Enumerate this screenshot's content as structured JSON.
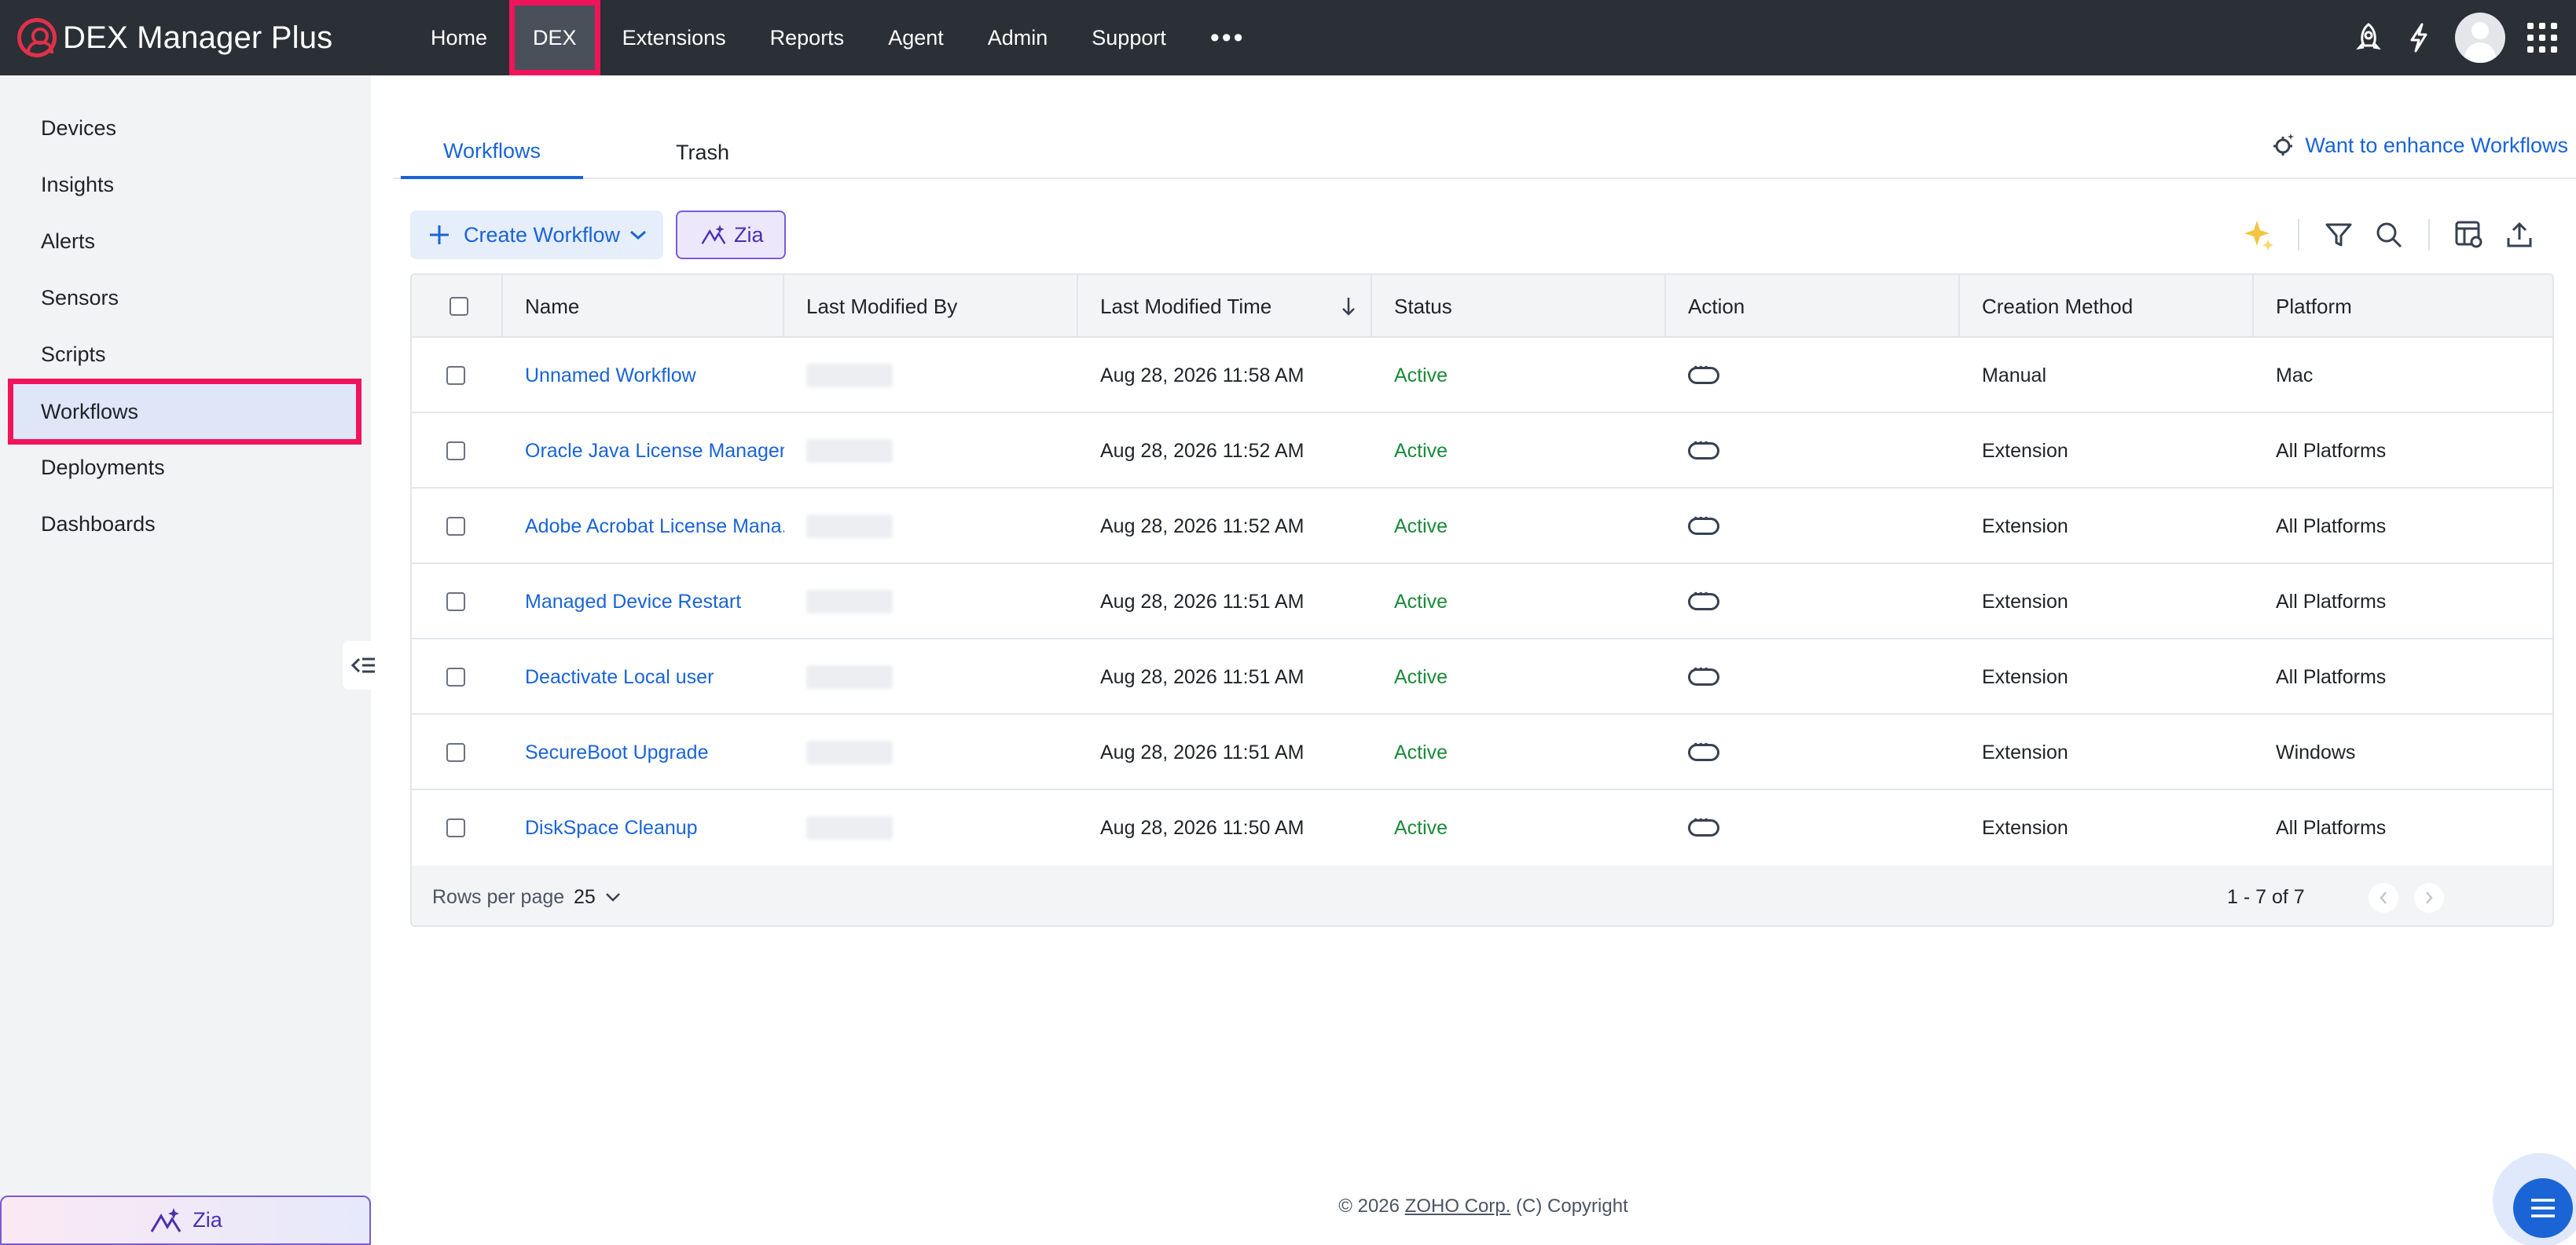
{
  "app": {
    "title": "DEX Manager Plus"
  },
  "nav": {
    "items": [
      {
        "label": "Home",
        "active": false
      },
      {
        "label": "DEX",
        "active": true
      },
      {
        "label": "Extensions",
        "active": false
      },
      {
        "label": "Reports",
        "active": false
      },
      {
        "label": "Agent",
        "active": false
      },
      {
        "label": "Admin",
        "active": false
      },
      {
        "label": "Support",
        "active": false
      }
    ],
    "more": "•••"
  },
  "sidebar": {
    "items": [
      {
        "label": "Devices"
      },
      {
        "label": "Insights"
      },
      {
        "label": "Alerts"
      },
      {
        "label": "Sensors"
      },
      {
        "label": "Scripts"
      },
      {
        "label": "Workflows",
        "active": true
      },
      {
        "label": "Deployments"
      },
      {
        "label": "Dashboards"
      }
    ],
    "zia_label": "Zia"
  },
  "tabs": [
    {
      "label": "Workflows",
      "active": true
    },
    {
      "label": "Trash",
      "active": false
    }
  ],
  "enhance_link": "Want to enhance Workflows",
  "toolbar": {
    "create_label": "Create Workflow",
    "zia_label": "Zia"
  },
  "table": {
    "columns": [
      "Name",
      "Last Modified By",
      "Last Modified Time",
      "Status",
      "Action",
      "Creation Method",
      "Platform"
    ],
    "rows": [
      {
        "name": "Unnamed Workflow",
        "time": "Aug 28, 2026 11:58 AM",
        "status": "Active",
        "method": "Manual",
        "platform": "Mac"
      },
      {
        "name": "Oracle Java License Managem...",
        "time": "Aug 28, 2026 11:52 AM",
        "status": "Active",
        "method": "Extension",
        "platform": "All Platforms"
      },
      {
        "name": "Adobe Acrobat License Mana...",
        "time": "Aug 28, 2026 11:52 AM",
        "status": "Active",
        "method": "Extension",
        "platform": "All Platforms"
      },
      {
        "name": "Managed Device Restart",
        "time": "Aug 28, 2026 11:51 AM",
        "status": "Active",
        "method": "Extension",
        "platform": "All Platforms"
      },
      {
        "name": "Deactivate Local user",
        "time": "Aug 28, 2026 11:51 AM",
        "status": "Active",
        "method": "Extension",
        "platform": "All Platforms"
      },
      {
        "name": "SecureBoot Upgrade",
        "time": "Aug 28, 2026 11:51 AM",
        "status": "Active",
        "method": "Extension",
        "platform": "Windows"
      },
      {
        "name": "DiskSpace Cleanup",
        "time": "Aug 28, 2026 11:50 AM",
        "status": "Active",
        "method": "Extension",
        "platform": "All Platforms"
      }
    ],
    "footer": {
      "rows_per_page_label": "Rows per page",
      "rows_per_page_value": "25",
      "range": "1 - 7 of 7"
    }
  },
  "footer": {
    "prefix": "© 2026",
    "company": "ZOHO Corp.",
    "suffix": "(C) Copyright"
  },
  "colors": {
    "topbar": "#2b2f36",
    "accent": "#1a64d6",
    "highlight": "#f0145a",
    "status_active": "#1b8a3a"
  }
}
